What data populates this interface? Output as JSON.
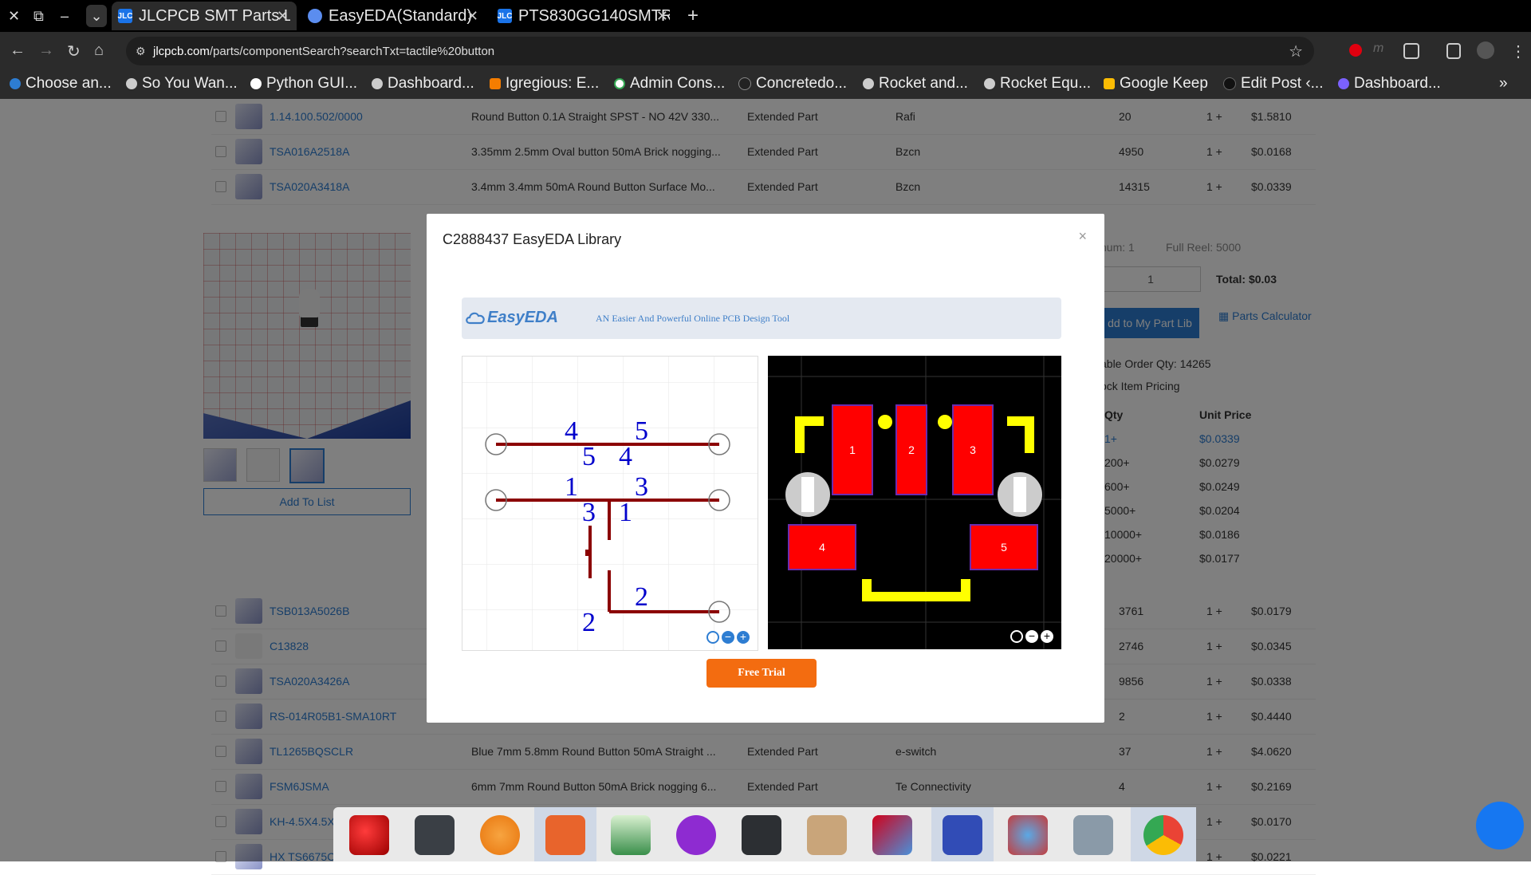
{
  "browser": {
    "tabs": [
      {
        "title": "JLCPCB SMT Parts Li",
        "icon": "jlc-icon",
        "active": true
      },
      {
        "title": "EasyEDA(Standard)",
        "icon": "easyeda-icon",
        "active": false
      },
      {
        "title": "PTS830GG140SMTR",
        "icon": "jlc-icon",
        "active": false
      }
    ],
    "favicon_text": "JLC",
    "url_host": "jlcpcb.com",
    "url_path": "/parts/componentSearch?searchTxt=tactile%20button",
    "bookmarks": [
      "Choose an...",
      "So You Wan...",
      "Python GUI...",
      "Dashboard...",
      "Igregious: E...",
      "Admin Cons...",
      "Concretedo...",
      "Rocket and...",
      "Rocket Equ...",
      "Google Keep",
      "Edit Post ‹...",
      "Dashboard..."
    ],
    "colors": {
      "chrome_bg": "#000000",
      "toolbar_bg": "#2b2b2b"
    }
  },
  "table_rows_top": [
    {
      "pn": "1.14.100.502/0000",
      "desc": "Round Button 0.1A Straight SPST - NO 42V 330...",
      "type": "Extended Part",
      "mfr": "Rafi",
      "stock": "20",
      "min": "1 +",
      "price": "$1.5810"
    },
    {
      "pn": "TSA016A2518A",
      "desc": "3.35mm 2.5mm Oval button 50mA Brick nogging...",
      "type": "Extended Part",
      "mfr": "Bzcn",
      "stock": "4950",
      "min": "1 +",
      "price": "$0.0168"
    },
    {
      "pn": "TSA020A3418A",
      "desc": "3.4mm 3.4mm 50mA Round Button Surface Mo...",
      "type": "Extended Part",
      "mfr": "Bzcn",
      "stock": "14315",
      "min": "1 +",
      "price": "$0.0339"
    }
  ],
  "table_rows_bottom": [
    {
      "pn": "TSB013A5026B",
      "desc": "",
      "type": "",
      "mfr": "",
      "stock": "3761",
      "min": "1 +",
      "price": "$0.0179"
    },
    {
      "pn": "C13828",
      "desc": "",
      "type": "",
      "mfr": "",
      "stock": "2746",
      "min": "1 +",
      "price": "$0.0345"
    },
    {
      "pn": "TSA020A3426A",
      "desc": "",
      "type": "",
      "mfr": "",
      "stock": "9856",
      "min": "1 +",
      "price": "$0.0338"
    },
    {
      "pn": "RS-014R05B1-SMA10RT",
      "desc": "",
      "type": "",
      "mfr": "",
      "stock": "2",
      "min": "1 +",
      "price": "$0.4440"
    },
    {
      "pn": "TL1265BQSCLR",
      "desc": "Blue 7mm 5.8mm Round Button 50mA Straight ...",
      "type": "Extended Part",
      "mfr": "e-switch",
      "stock": "37",
      "min": "1 +",
      "price": "$4.0620"
    },
    {
      "pn": "FSM6JSMA",
      "desc": "6mm 7mm Round Button 50mA Brick nogging 6...",
      "type": "Extended Part",
      "mfr": "Te Connectivity",
      "stock": "4",
      "min": "1 +",
      "price": "$0.2169"
    },
    {
      "pn": "KH-4.5X4.5X",
      "desc": "",
      "type": "",
      "mfr": "",
      "stock": "",
      "min": "1 +",
      "price": "$0.0170"
    },
    {
      "pn": "HX TS6675C",
      "desc": "",
      "type": "",
      "mfr": "",
      "stock": "",
      "min": "1 +",
      "price": "$0.0221"
    }
  ],
  "detail": {
    "add_to_list": "Add To List",
    "minimum": "num: 1",
    "full_reel": "Full Reel: 5000",
    "qty_value": "1",
    "total": "Total: $0.03",
    "add_to_lib": "dd to My Part Lib",
    "parts_calc": "Parts Calculator",
    "order_qty": "able Order Qty: 14265",
    "stock_pricing": "ock Item Pricing",
    "price_header_qty": "Qty",
    "price_header_unit": "Unit Price",
    "price_breaks": [
      {
        "qty": "1+",
        "price": "$0.0339"
      },
      {
        "qty": "200+",
        "price": "$0.0279"
      },
      {
        "qty": "600+",
        "price": "$0.0249"
      },
      {
        "qty": "5000+",
        "price": "$0.0204"
      },
      {
        "qty": "10000+",
        "price": "$0.0186"
      },
      {
        "qty": "20000+",
        "price": "$0.0177"
      }
    ]
  },
  "modal": {
    "title": "C2888437 EasyEDA Library",
    "close": "×",
    "logo": "EasyEDA",
    "tagline": "AN Easier And Powerful Online PCB Design Tool",
    "free_trial": "Free Trial",
    "schematic_pins": [
      "4",
      "5",
      "5",
      "4",
      "1",
      "3",
      "3",
      "1",
      "2",
      "2"
    ],
    "pads": [
      "1",
      "2",
      "3",
      "4",
      "5"
    ],
    "colors": {
      "wire": "#8b0000",
      "pin_text": "#0000cc",
      "pad": "#ff0000",
      "silk": "#ffff00",
      "hole": "#cccccc"
    }
  },
  "dock": {
    "apps": [
      "falcon-icon",
      "terminal-icon",
      "blender-icon",
      "files-icon",
      "image-viewer-icon",
      "s-app-icon",
      "mixer-icon",
      "archive-icon",
      "freecad-icon",
      "kicad-icon",
      "inkscape-icon",
      "screenshot-icon",
      "chrome-icon"
    ]
  }
}
